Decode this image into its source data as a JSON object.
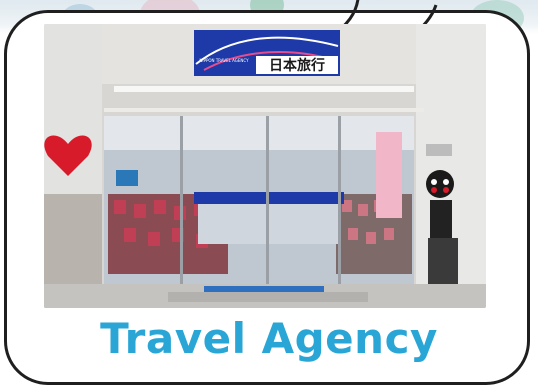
{
  "photo": {
    "sign_text": "日本旅行",
    "sign_small_text": "NIPPON TRAVEL AGENCY"
  },
  "caption": {
    "text": "Travel Agency"
  },
  "colors": {
    "caption": "#2aa6d6",
    "frame": "#1f1f1f",
    "sign_blue": "#1e3aa8",
    "heart_red": "#d81b2a"
  }
}
